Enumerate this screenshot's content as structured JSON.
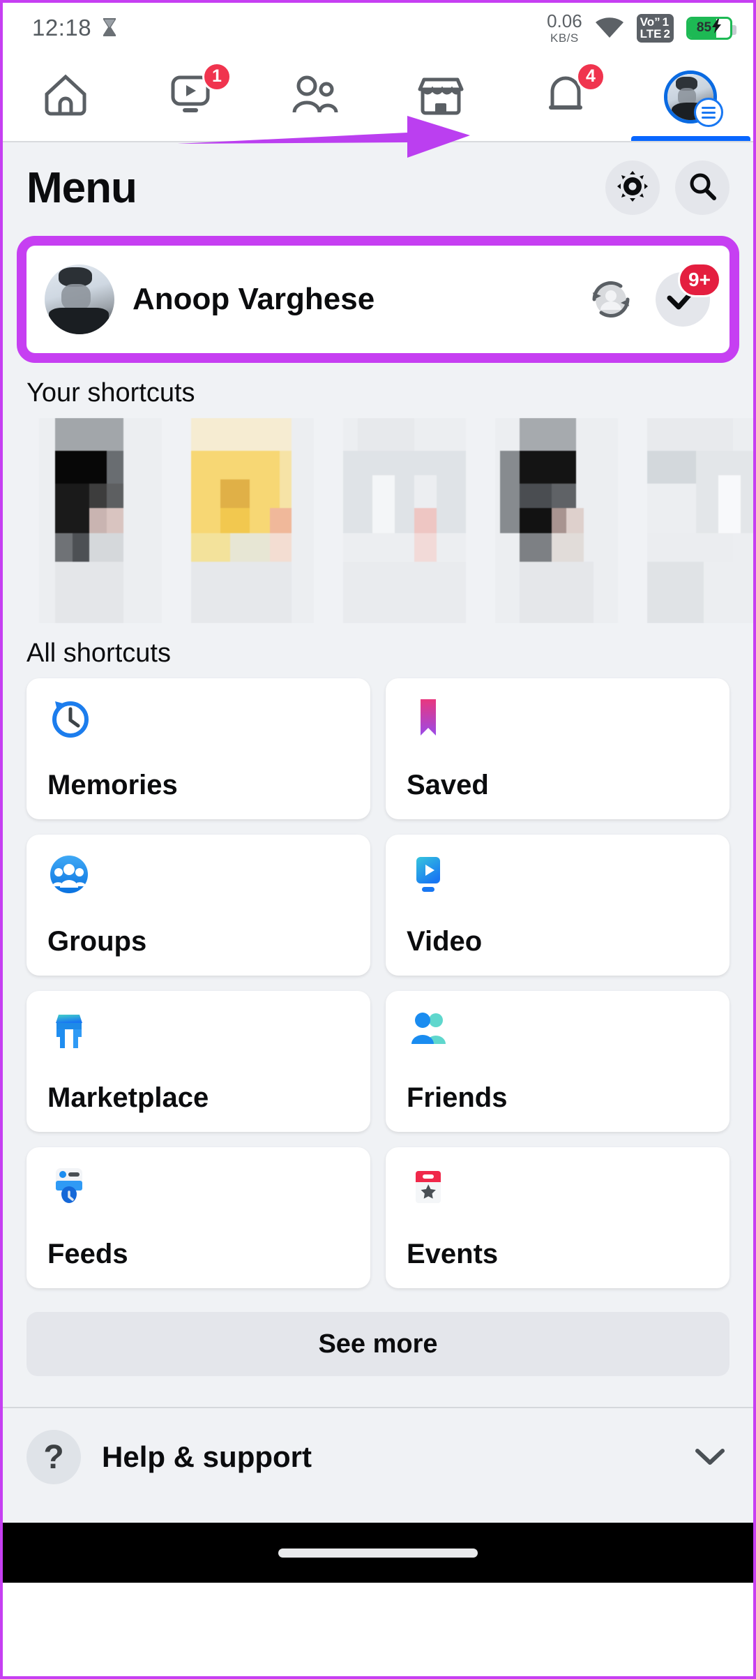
{
  "status_bar": {
    "time": "12:18",
    "hourglass_icon": "hourglass-icon",
    "network_speed": "0.06",
    "network_speed_unit": "KB/S",
    "wifi_icon": "wifi-icon",
    "volte_line1": "Vo”",
    "volte_sim1": "1",
    "volte_line2": "LTE",
    "volte_sim2": "2",
    "battery_percent": "85",
    "battery_charging_icon": "lightning-bolt-icon"
  },
  "top_nav": {
    "tabs": [
      {
        "name": "home",
        "icon": "home-icon",
        "badge": "",
        "active": false
      },
      {
        "name": "video",
        "icon": "video-icon",
        "badge": "1",
        "active": false
      },
      {
        "name": "friends",
        "icon": "friends-icon",
        "badge": "",
        "active": false
      },
      {
        "name": "marketplace",
        "icon": "marketplace-icon",
        "badge": "",
        "active": false
      },
      {
        "name": "notifications",
        "icon": "bell-icon",
        "badge": "4",
        "active": false
      },
      {
        "name": "menu-profile",
        "icon": "profile-avatar-menu-icon",
        "badge": "",
        "active": true
      }
    ]
  },
  "annotation": {
    "arrow_color": "#c63ff2",
    "highlight_color": "#c63ff2",
    "points_to": "menu-profile-tab"
  },
  "menu": {
    "title": "Menu",
    "settings_icon": "gear-icon",
    "search_icon": "search-icon"
  },
  "profile": {
    "name": "Anoop Varghese",
    "switch_account_icon": "switch-account-icon",
    "check_icon": "checkmark-icon",
    "check_badge": "9+"
  },
  "your_shortcuts": {
    "heading": "Your shortcuts",
    "tiles": [
      {
        "name": "shortcut-thumb-1",
        "tone": "gray"
      },
      {
        "name": "shortcut-thumb-2",
        "tone": "yellow"
      },
      {
        "name": "shortcut-thumb-3",
        "tone": "light"
      },
      {
        "name": "shortcut-thumb-4",
        "tone": "gray"
      },
      {
        "name": "shortcut-thumb-5",
        "tone": "light"
      }
    ]
  },
  "all_shortcuts": {
    "heading": "All shortcuts",
    "items": [
      {
        "label": "Memories",
        "icon": "clock-rewind-icon",
        "color": "#1c7ded"
      },
      {
        "label": "Saved",
        "icon": "bookmark-icon",
        "color": "#d63aa4"
      },
      {
        "label": "Groups",
        "icon": "groups-icon",
        "color": "#1a8cf0"
      },
      {
        "label": "Video",
        "icon": "video-play-icon",
        "color": "#2aa7e8"
      },
      {
        "label": "Marketplace",
        "icon": "storefront-icon",
        "color": "#2bb8d8"
      },
      {
        "label": "Friends",
        "icon": "friends-pair-icon",
        "color": "#1a8cf0"
      },
      {
        "label": "Feeds",
        "icon": "feeds-icon",
        "color": "#1877f2"
      },
      {
        "label": "Events",
        "icon": "calendar-star-icon",
        "color": "#f0284a"
      }
    ],
    "see_more_label": "See more"
  },
  "footer": {
    "help_label": "Help & support",
    "help_icon": "question-mark-icon",
    "chevron_icon": "chevron-down-icon"
  },
  "system_nav": {
    "home_pill": "home-pill-indicator"
  }
}
